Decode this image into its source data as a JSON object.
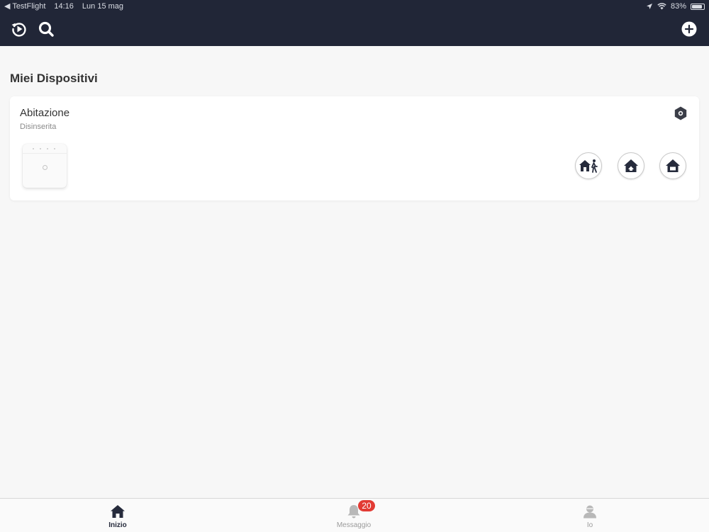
{
  "status_bar": {
    "back_app": "◀ TestFlight",
    "time": "14:16",
    "date": "Lun 15 mag",
    "battery": "83%"
  },
  "nav": {
    "left_icons": [
      "playback-icon",
      "search-icon"
    ],
    "right_icon": "add-icon"
  },
  "main": {
    "section_title": "Miei Dispositivi",
    "device": {
      "name": "Abitazione",
      "status": "Disinserita",
      "settings_icon": "hexagon-settings-icon",
      "mode_buttons": [
        "away-arm-icon",
        "stay-arm-icon",
        "disarm-icon"
      ]
    }
  },
  "tabs": [
    {
      "label": "Inizio",
      "icon": "home-icon",
      "active": true
    },
    {
      "label": "Messaggio",
      "icon": "bell-icon",
      "badge": "20"
    },
    {
      "label": "Io",
      "icon": "user-icon"
    }
  ],
  "colors": {
    "header_bg": "#212637",
    "badge": "#e23b34",
    "active_tab": "#262b3c",
    "inactive_tab": "#9b9b9b"
  }
}
